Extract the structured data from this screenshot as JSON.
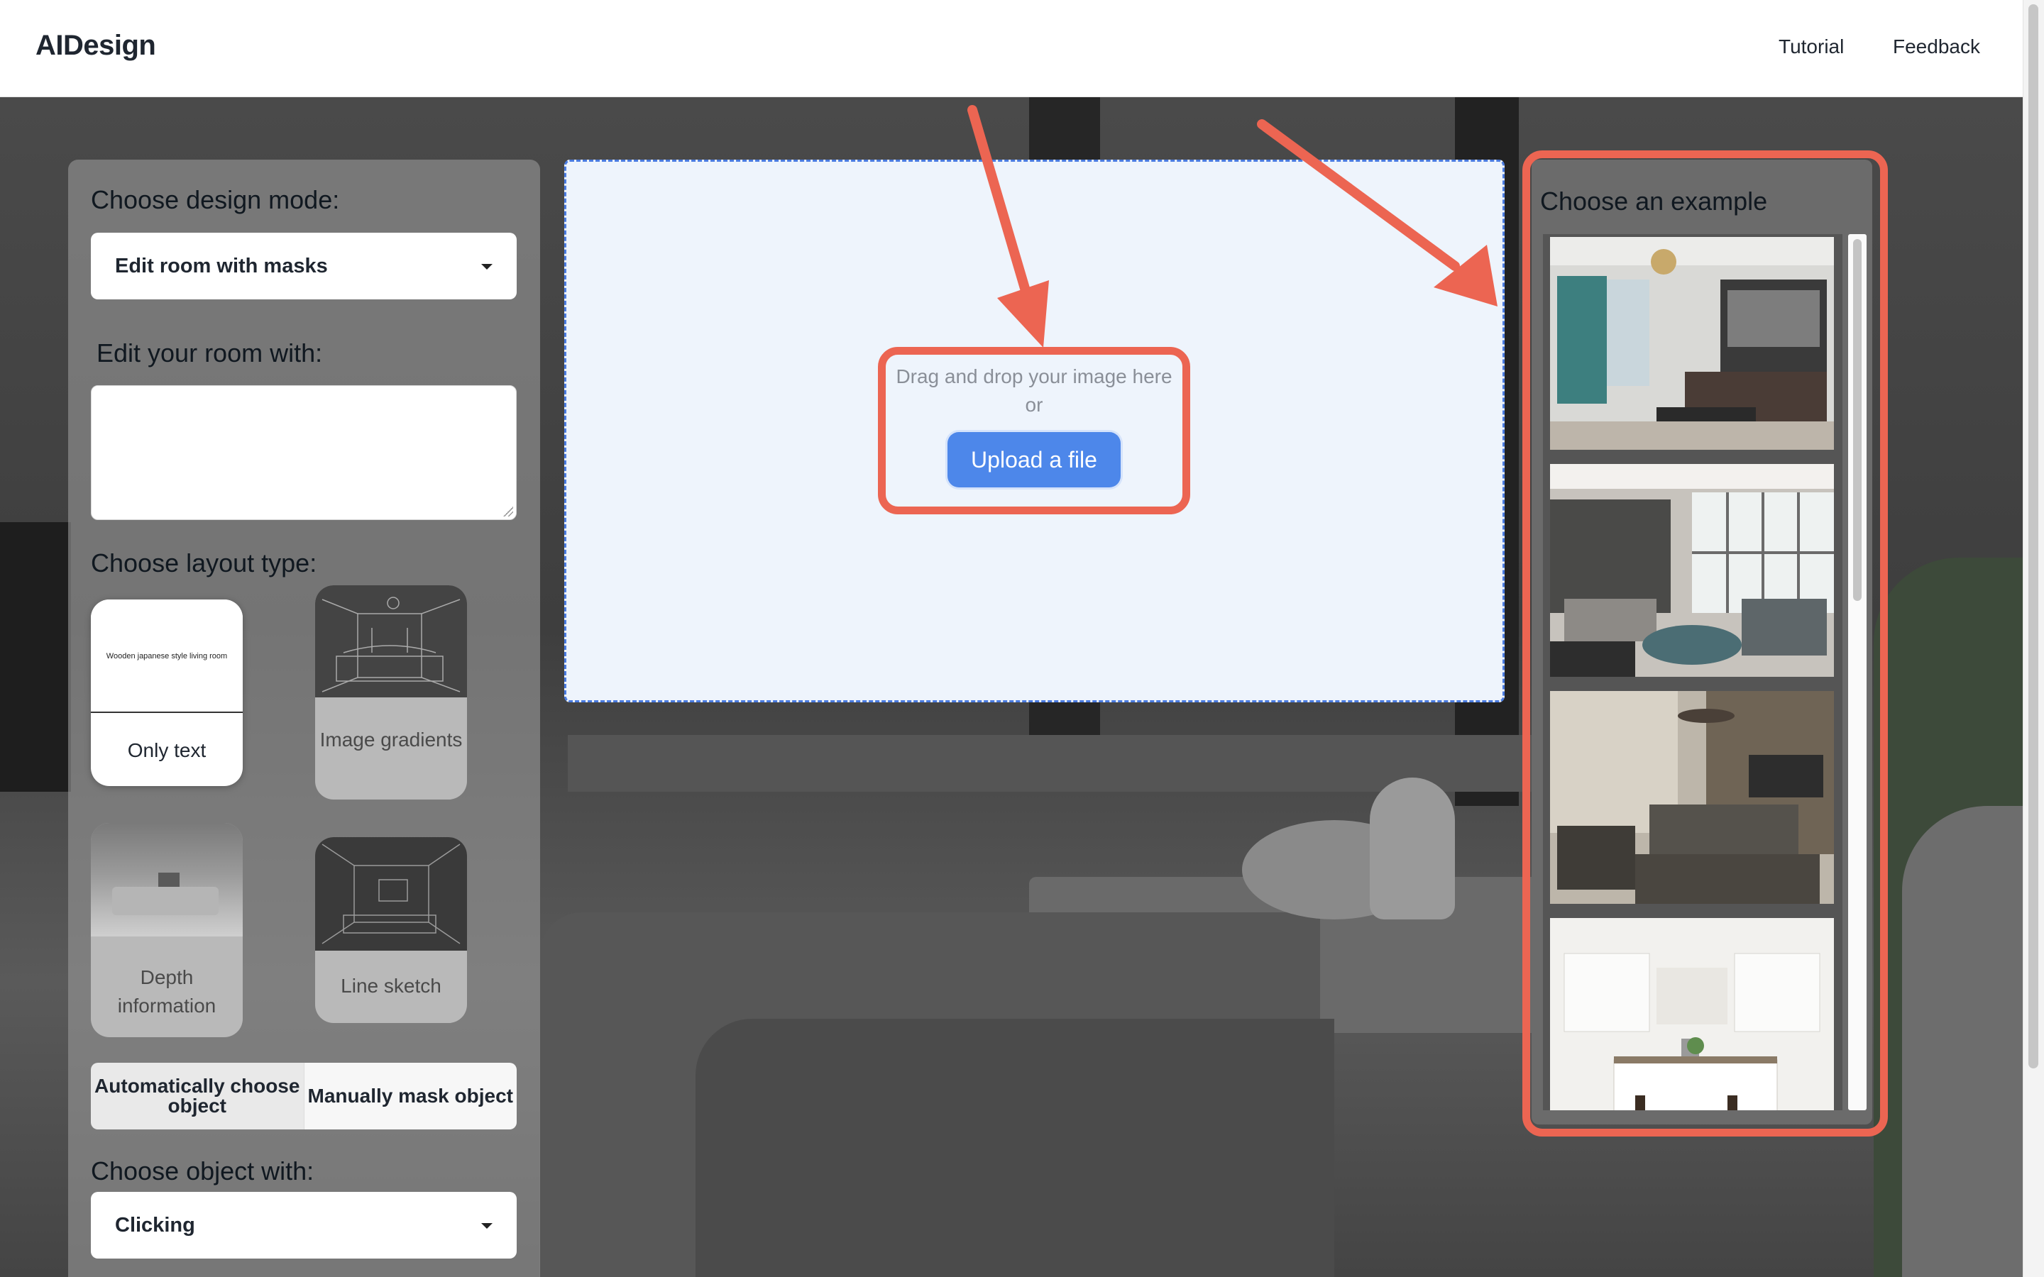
{
  "header": {
    "brand": "AIDesign",
    "nav": {
      "tutorial": "Tutorial",
      "feedback": "Feedback"
    }
  },
  "left_panel": {
    "design_mode_heading": "Choose design mode:",
    "design_mode_value": "Edit room with masks",
    "edit_heading": "Edit your room with:",
    "edit_value": "",
    "layout_heading": "Choose layout type:",
    "layout_types": [
      {
        "label": "Only text",
        "thumb_caption": "Wooden japanese style living room",
        "selected": true
      },
      {
        "label": "Image gradients",
        "selected": false
      },
      {
        "label": "Depth information",
        "selected": false
      },
      {
        "label": "Line sketch",
        "selected": false
      }
    ],
    "mask_modes": {
      "auto": "Automatically choose object",
      "manual": "Manually mask object"
    },
    "object_heading": "Choose object with:",
    "object_value": "Clicking"
  },
  "upload": {
    "drag_text": "Drag and drop your image here",
    "or_text": "or",
    "button_label": "Upload a file"
  },
  "examples": {
    "heading": "Choose an example",
    "items": [
      "living-room-teal-curtains",
      "living-room-large-windows",
      "living-room-tufted-sofa",
      "white-kitchen"
    ]
  },
  "colors": {
    "annotation_red": "#ec6552",
    "upload_blue": "#4d87ea",
    "dropzone_bg": "#eef4fc"
  }
}
